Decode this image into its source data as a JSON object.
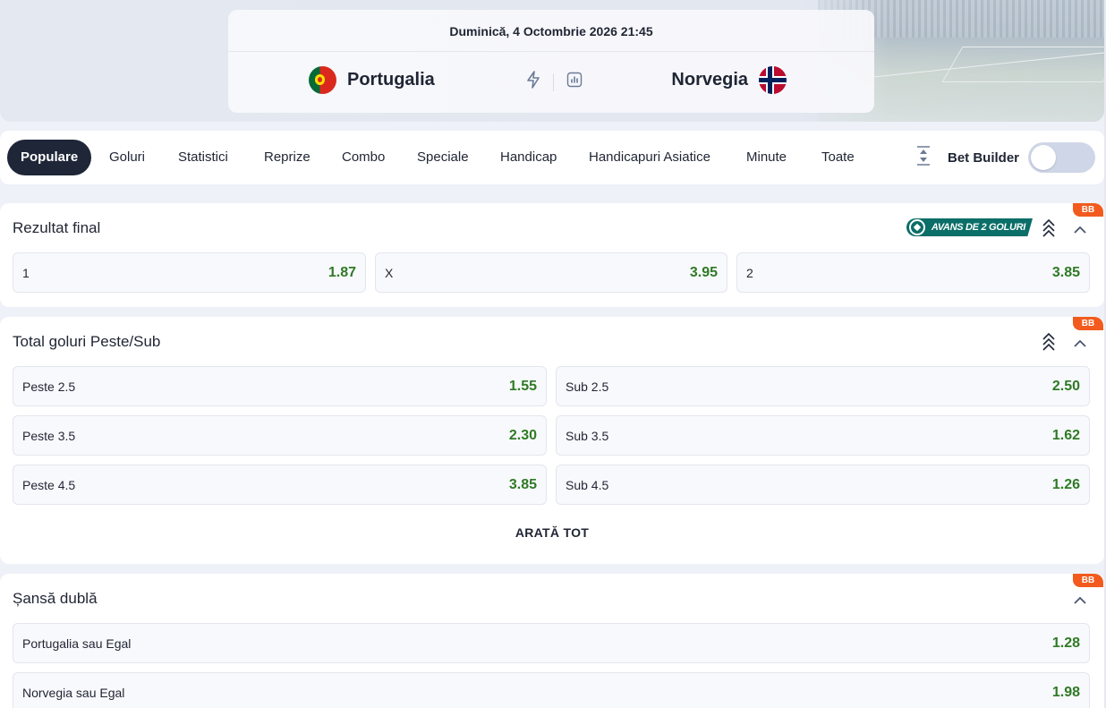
{
  "match": {
    "date": "Duminică, 4 Octombrie 2026 21:45",
    "home_team": "Portugalia",
    "away_team": "Norvegia",
    "home_flag": "portugal-flag",
    "away_flag": "norway-flag",
    "icons": [
      "lightning-icon",
      "stats-icon"
    ]
  },
  "tabs": {
    "items": [
      "Populare",
      "Goluri",
      "Statistici",
      "Reprize",
      "Combo",
      "Speciale",
      "Handicap",
      "Handicapuri Asiatice",
      "Minute",
      "Toate"
    ],
    "active": "Populare",
    "bet_builder_label": "Bet Builder",
    "bet_builder_on": false
  },
  "colors": {
    "odds_green": "#2f7a25",
    "badge_orange": "#f25b1d",
    "promo_teal": "#0b6e68",
    "active_tab": "#1e2638"
  },
  "markets": {
    "result": {
      "title": "Rezultat final",
      "badge": "BB",
      "promo": "AVANS DE 2 GOLURI",
      "odds": [
        {
          "label": "1",
          "value": "1.87"
        },
        {
          "label": "X",
          "value": "3.95"
        },
        {
          "label": "2",
          "value": "3.85"
        }
      ]
    },
    "totals": {
      "title": "Total goluri Peste/Sub",
      "badge": "BB",
      "odds": [
        {
          "label": "Peste 2.5",
          "value": "1.55"
        },
        {
          "label": "Sub 2.5",
          "value": "2.50"
        },
        {
          "label": "Peste 3.5",
          "value": "2.30"
        },
        {
          "label": "Sub 3.5",
          "value": "1.62"
        },
        {
          "label": "Peste 4.5",
          "value": "3.85"
        },
        {
          "label": "Sub 4.5",
          "value": "1.26"
        }
      ],
      "show_all": "ARATĂ TOT"
    },
    "double_chance": {
      "title": "Șansă dublă",
      "badge": "BB",
      "odds": [
        {
          "label": "Portugalia sau Egal",
          "value": "1.28"
        },
        {
          "label": "Norvegia sau Egal",
          "value": "1.98"
        }
      ]
    }
  }
}
